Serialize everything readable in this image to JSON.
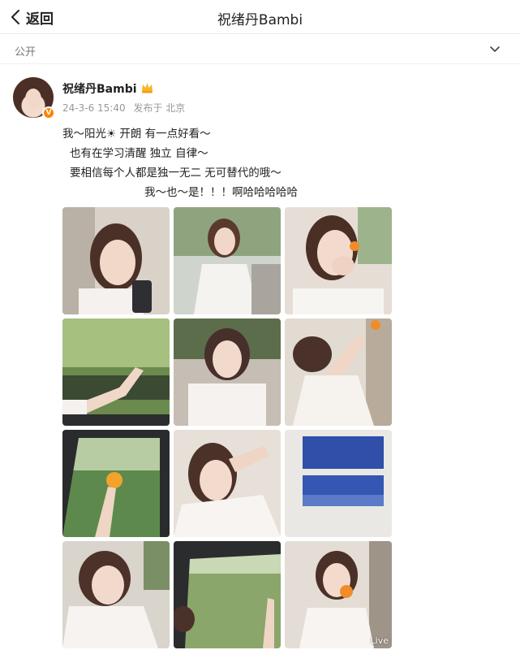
{
  "header": {
    "back_label": "返回",
    "title": "祝绪丹Bambi"
  },
  "visibility": {
    "label": "公开"
  },
  "post": {
    "author": "祝绪丹Bambi",
    "time": "24-3-6 15:40",
    "location": "发布于 北京",
    "text_lines": [
      "我～阳光☀ 开朗 有一点好看～",
      "也有在学习清醒 独立 自律～",
      "要相信每个人都是独一无二 无可替代的哦～",
      "我～也～是！！！啊哈哈哈哈哈"
    ],
    "live_badge": "Live"
  },
  "images": [
    {
      "name": "photo-1-selfie-phone",
      "bg": "#d8d2c8"
    },
    {
      "name": "photo-2-car-white-shirt",
      "bg": "#cfd4cd"
    },
    {
      "name": "photo-3-covering-mouth",
      "bg": "#e6ded6"
    },
    {
      "name": "photo-4-hand-out-window",
      "bg": "#6b8a4e"
    },
    {
      "name": "photo-5-portrait-car",
      "bg": "#c6bdb4"
    },
    {
      "name": "photo-6-arm-up-orange",
      "bg": "#e2dbd2"
    },
    {
      "name": "photo-7-orange-window-palms",
      "bg": "#5d8a4c"
    },
    {
      "name": "photo-8-arm-over-head",
      "bg": "#e7e0d8"
    },
    {
      "name": "photo-9-blue-moon-cards",
      "bg": "#eae8e4"
    },
    {
      "name": "photo-10-lean-head",
      "bg": "#d9d4cc"
    },
    {
      "name": "photo-11-palms-view",
      "bg": "#8aa66b"
    },
    {
      "name": "photo-12-holding-orange",
      "bg": "#e3ddd5"
    }
  ]
}
